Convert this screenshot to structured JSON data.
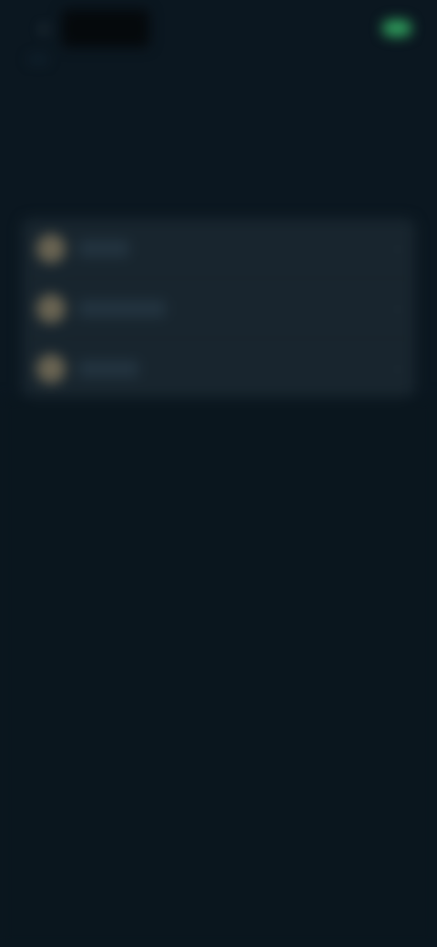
{
  "colors": {
    "background": "#0b1720",
    "card": "#18252e",
    "accent": "#2f9e5c",
    "icon_circle": "#6a6452"
  },
  "header": {
    "back_icon": "chevron-left-icon",
    "logo_text": "",
    "right_text": "",
    "status_pill": "green-toggle"
  },
  "subtitle": "",
  "title": {
    "line1": "",
    "line2": ""
  },
  "options": [
    {
      "icon": "option-icon",
      "label": ""
    },
    {
      "icon": "option-icon",
      "label": ""
    },
    {
      "icon": "option-icon",
      "label": ""
    }
  ]
}
